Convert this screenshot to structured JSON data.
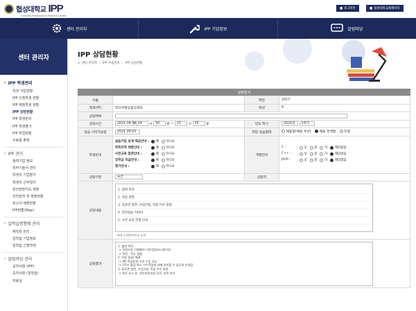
{
  "header": {
    "logo_text": "협성대학교",
    "logo_brand": "IPP",
    "logo_sub": "Industry Professional Practice Center",
    "login_btn": "로그아웃",
    "home_btn": "협성대학교홈페이지"
  },
  "nav": [
    {
      "label": "센터 관리자",
      "icon": "gear-icon"
    },
    {
      "label": "IPP 기업정보",
      "icon": "wrench-icon"
    },
    {
      "label": "알림마당",
      "icon": "chat-icon"
    }
  ],
  "sidebar": {
    "title": "센터 관리자",
    "sections": [
      {
        "head": "IPP 학생관리",
        "items": [
          "학생 가입현황",
          "IPP 신청학생 현황",
          "IPP 배정학생 현황",
          "IPP 상담현황",
          "IPP 학생관리",
          "IPP 학생평가",
          "IPP 취업현황",
          "수료증 출력"
        ],
        "active_item": "IPP 상담현황"
      },
      {
        "head": "IPP 관리",
        "items": [
          "참여기업 정보",
          "직무기술서 관리",
          "학생의 기업평가",
          "학생의 근무일지",
          "관리현장지도 현황",
          "안전관리 및 행정현황",
          "보고서 제출현황",
          "IPP현황(Map)"
        ]
      },
      {
        "head": "일학습병행제 관리",
        "items": [
          "재직원 관리",
          "일학습 기업정보",
          "일학습 신청학생"
        ]
      },
      {
        "head": "알림마당 관리",
        "items": [
          "공지사항 (IPP)",
          "공지사항 (일학습)",
          "자료실"
        ]
      }
    ]
  },
  "page": {
    "title": "IPP 상담현황",
    "breadcrumb": [
      "센터 관리자",
      "IPP 학생관리",
      "IPP 상담현황"
    ]
  },
  "form": {
    "header": "상담일지",
    "labels": {
      "name": "이름",
      "student_no": "학번",
      "dept": "학과(부)",
      "grade": "학년",
      "subject": "상담제목",
      "time": "상담시간",
      "year_term": "년도 학기",
      "start_date": "실습 시작가능일",
      "hope": "희망 실습형태",
      "guide": "학생안내",
      "lang": "개발언어",
      "type": "상담구분",
      "counselor": "상담자",
      "content": "상담내용",
      "result": "상담결과"
    },
    "values": {
      "student_no": "2017",
      "dept": "미디어영상광고학과",
      "grade": "4",
      "date": "2021.04.06",
      "hour1": "14",
      "min1": "30",
      "sep_from": "분 ~",
      "hour2": "15",
      "min2": "30",
      "unit_hour": "시",
      "unit_min": "분",
      "year": "2021년",
      "term": "1학기",
      "start_date": "2021.09.01",
      "type": "요건"
    },
    "hope_options": [
      {
        "label": "채용형(채용 우선)",
        "on": false
      },
      {
        "label": "채용 연계형",
        "on": true
      },
      {
        "label": "미정",
        "on": false
      }
    ],
    "guide_rows": [
      {
        "label": "실습기업 상세 제공안내 :"
      },
      {
        "label": "취득자격 체증안내 :"
      },
      {
        "label": "사전교육 참관안내 :"
      },
      {
        "label": "장학금 지급안내 :"
      },
      {
        "label": "평가안내 :"
      }
    ],
    "yes": "예",
    "no": "아니요",
    "lang_rows": [
      {
        "name": "C :"
      },
      {
        "name": "C++ :"
      },
      {
        "name": "JAVA :"
      }
    ],
    "lang_levels": [
      "상",
      "중",
      "하",
      "해당없음"
    ],
    "content_lines": [
      "1. 참여 목적",
      "2. 직장 경험",
      "3. 동료관 방면, 수업신청, 학점 이수 방법",
      "4. 현장실습 지원비",
      "5. 사전 교육 진행 안내"
    ],
    "content_limit": "- 최대 1,000자까지 입력",
    "result_lines": [
      "1. 참여 목적",
      "-> 직장기업 이벤페이/ 마트컴퓨터니케이션",
      "-> 목적 : 직무 경험",
      " ",
      "2. 직장 점검/ 배례",
      "-> IPP 학점인정 수료 수강 가능",
      "-> 1학기 졸업 최소 이수학점에 대해 관리할 수 있도록 안내함.",
      " ",
      "3. 동료관 방면, 수업신청, 학점 이수 방법",
      "-> 향후 요소 운, 관리지원과정 진로, 과목 분석"
    ]
  }
}
